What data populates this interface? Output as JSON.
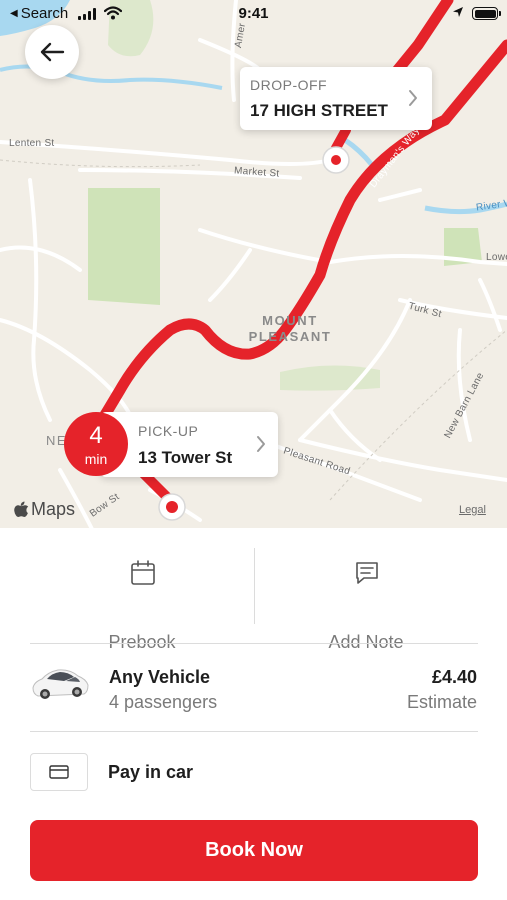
{
  "status_bar": {
    "back_app": "Search",
    "time": "9:41"
  },
  "map": {
    "streets": [
      "Lenten St",
      "Market St",
      "Drayman's Way",
      "River W",
      "Lowe",
      "Turk St",
      "New Barn Lane",
      "Pleasant Road",
      "Bow St",
      "Amer"
    ],
    "area_label_line1": "MOUNT",
    "area_label_line2": "PLEASANT",
    "partial_label": "NE",
    "dropoff": {
      "title": "DROP-OFF",
      "address": "17 HIGH STREET"
    },
    "pickup": {
      "title": "PICK-UP",
      "address": "13 Tower St"
    },
    "eta": {
      "value": "4",
      "unit": "min"
    },
    "maps_brand": "Maps",
    "legal": "Legal",
    "colors": {
      "route": "#e5232a",
      "water": "#a8d8f0",
      "park": "#cfe3b8",
      "land": "#f2eee6"
    }
  },
  "actions": {
    "prebook": "Prebook",
    "add_note": "Add Note"
  },
  "vehicle": {
    "name": "Any Vehicle",
    "capacity": "4 passengers",
    "price": "£4.40",
    "price_note": "Estimate"
  },
  "payment": {
    "method": "Pay in car"
  },
  "book_button": "Book Now",
  "accent_color": "#e5232a"
}
